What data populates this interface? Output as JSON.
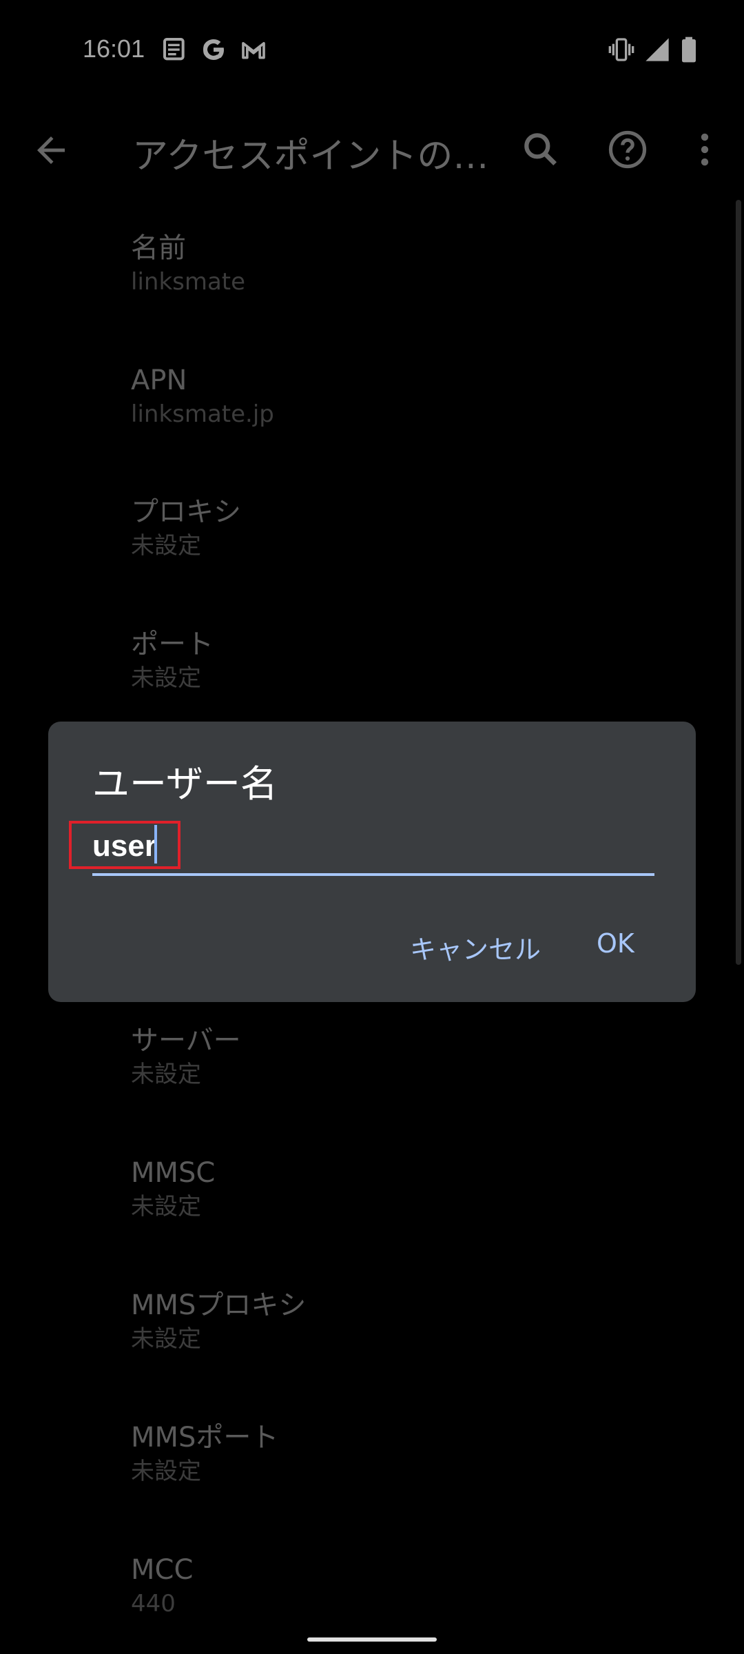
{
  "status_bar": {
    "time": "16:01",
    "left_icons": [
      "news-icon",
      "google-icon",
      "gmail-icon"
    ],
    "right_icons": [
      "vibrate-icon",
      "signal-icon",
      "battery-icon"
    ]
  },
  "app_bar": {
    "title": "アクセスポイントの…",
    "icons": [
      "back-arrow-icon",
      "search-icon",
      "help-icon",
      "more-vert-icon"
    ]
  },
  "settings": {
    "items": [
      {
        "label": "名前",
        "value": "linksmate"
      },
      {
        "label": "APN",
        "value": "linksmate.jp"
      },
      {
        "label": "プロキシ",
        "value": "未設定"
      },
      {
        "label": "ポート",
        "value": "未設定"
      },
      {
        "label": "サーバー",
        "value": "未設定"
      },
      {
        "label": "MMSC",
        "value": "未設定"
      },
      {
        "label": "MMSプロキシ",
        "value": "未設定"
      },
      {
        "label": "MMSポート",
        "value": "未設定"
      },
      {
        "label": "MCC",
        "value": "440"
      }
    ]
  },
  "dialog": {
    "title": "ユーザー名",
    "input_value": "user",
    "cancel_label": "キャンセル",
    "ok_label": "OK",
    "accent_color": "#a8c7fa",
    "highlight_color": "#e0202a"
  }
}
